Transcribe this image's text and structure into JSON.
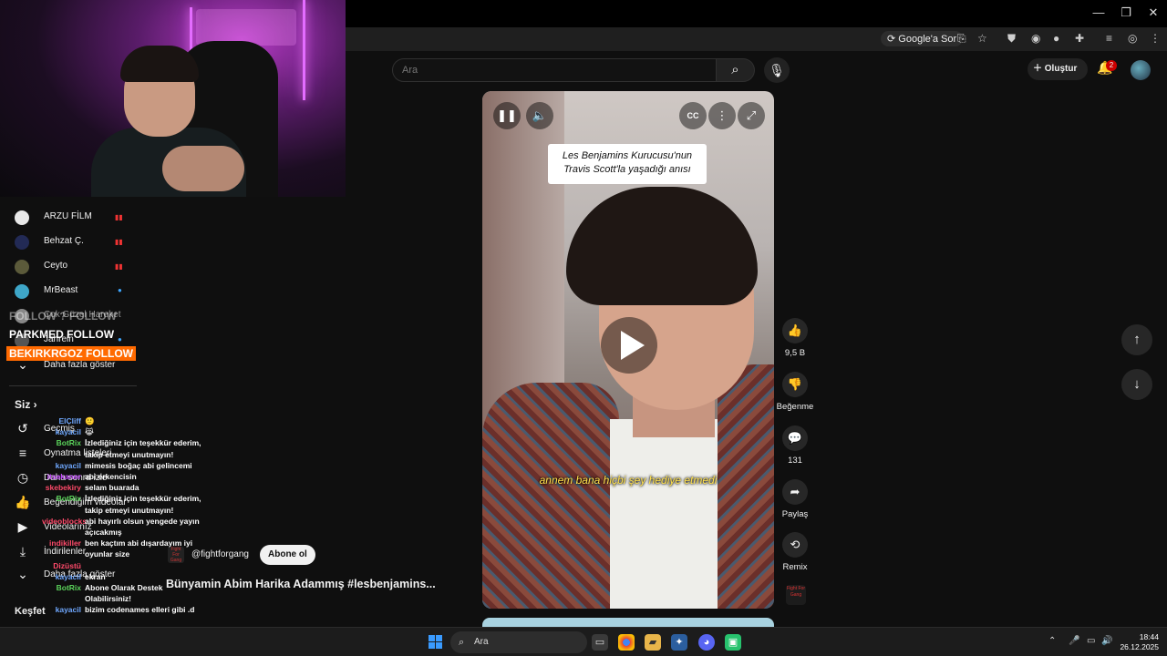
{
  "browser": {
    "google_sor": "Google'a Sor",
    "window_controls": [
      "—",
      "❐",
      "✕"
    ]
  },
  "header": {
    "search_placeholder": "Ara",
    "create_label": "Oluştur",
    "notification_count": "2"
  },
  "sidebar": {
    "subscriptions": [
      {
        "name": "ARZU FİLM",
        "avatar_color": "#e8e8e8",
        "indicator": "live"
      },
      {
        "name": "Behzat Ç.",
        "avatar_color": "#222a55",
        "indicator": "live"
      },
      {
        "name": "Ceyto",
        "avatar_color": "#5b5a3a",
        "indicator": "live"
      },
      {
        "name": "MrBeast",
        "avatar_color": "#3ea6c8",
        "indicator": "dot"
      },
      {
        "name": "Çok Güzel Hareket",
        "avatar_color": "#888888",
        "indicator": "none"
      },
      {
        "name": "Jahrein",
        "avatar_color": "#555555",
        "indicator": "dot"
      }
    ],
    "show_more": "Daha fazla göster",
    "you_title": "Siz",
    "you_items": [
      {
        "label": "Geçmiş",
        "icon": "↺"
      },
      {
        "label": "Oynatma listeleri",
        "icon": "≡"
      },
      {
        "label": "Daha sonra izle",
        "icon": "◷"
      },
      {
        "label": "Beğendiğim videolar",
        "icon": "👍"
      },
      {
        "label": "Videolarınız",
        "icon": "▶"
      },
      {
        "label": "İndirilenler",
        "icon": "⤓"
      }
    ],
    "you_show_more": "Daha fazla göster",
    "explore": "Keşfet"
  },
  "overlay": {
    "follow1": "FOLLOW ? FOLLOW",
    "follow2": "PARKMED FOLLOW",
    "follow3": "BEKIRKRGOZ FOLLOW"
  },
  "chat": [
    {
      "user": "ElCliff",
      "color": "#6fa8ff",
      "msg": "🙂"
    },
    {
      "user": "kayacil",
      "color": "#6fa8ff",
      "msg": "😹"
    },
    {
      "user": "BotRix",
      "color": "#5bd35b",
      "msg": "İzlediğiniz için teşekkür ederim,"
    },
    {
      "user": "",
      "color": "#ffffff",
      "msg": "takip etmeyi unutmayın!"
    },
    {
      "user": "kayacil",
      "color": "#6fa8ff",
      "msg": "mimesis boğaç abi gelincemi"
    },
    {
      "user": "itsekaner",
      "color": "#c54aff",
      "msg": "abi erkencisin"
    },
    {
      "user": "skebekiry",
      "color": "#ff4a6a",
      "msg": "selam buarada"
    },
    {
      "user": "BotRix",
      "color": "#5bd35b",
      "msg": "İzlediğiniz için teşekkür ederim,"
    },
    {
      "user": "",
      "color": "#ffffff",
      "msg": "takip etmeyi unutmayın!"
    },
    {
      "user": "videoblocks",
      "color": "#ff4a6a",
      "msg": "abi hayırlı olsun yengede yayın"
    },
    {
      "user": "",
      "color": "#ffffff",
      "msg": "açıcakmış"
    },
    {
      "user": "indikiller",
      "color": "#ff4a6a",
      "msg": "ben kaçtım abi dışardayım iyi"
    },
    {
      "user": "",
      "color": "#ffffff",
      "msg": "oyunlar size"
    },
    {
      "user": "Dizüstü",
      "color": "#ff4a6a",
      "msg": ""
    },
    {
      "user": "kayacil",
      "color": "#6fa8ff",
      "msg": "ekran"
    },
    {
      "user": "BotRix",
      "color": "#5bd35b",
      "msg": "Abone Olarak Destek"
    },
    {
      "user": "",
      "color": "#ffffff",
      "msg": "Olabilirsiniz!"
    },
    {
      "user": "kayacil",
      "color": "#6fa8ff",
      "msg": "bizim codenames elleri gibi .d"
    }
  ],
  "video": {
    "caption_line1": "Les Benjamins Kurucusu'nun",
    "caption_line2": "Travis Scott'la yaşadığı anısı",
    "subtitle": "annem bana hiçbi şey hediye etmedi",
    "cc_label": "CC",
    "channel_name": "@fightforgang",
    "subscribe_label": "Abone ol",
    "title": "Bünyamin Abim Harika Adammış #lesbenjamins..."
  },
  "actions": {
    "like_count": "9,5 B",
    "dislike_label": "Beğenme",
    "comment_count": "131",
    "share_label": "Paylaş",
    "remix_label": "Remix",
    "remix_thumb_text": "Fight For Gang"
  },
  "taskbar": {
    "search_label": "Ara",
    "time": "18:44",
    "date": "26.12.2025"
  },
  "colors": {
    "accent_red": "#cc0000",
    "follow_orange": "#ff6a00",
    "subtitle_yellow": "#ffe14d"
  }
}
